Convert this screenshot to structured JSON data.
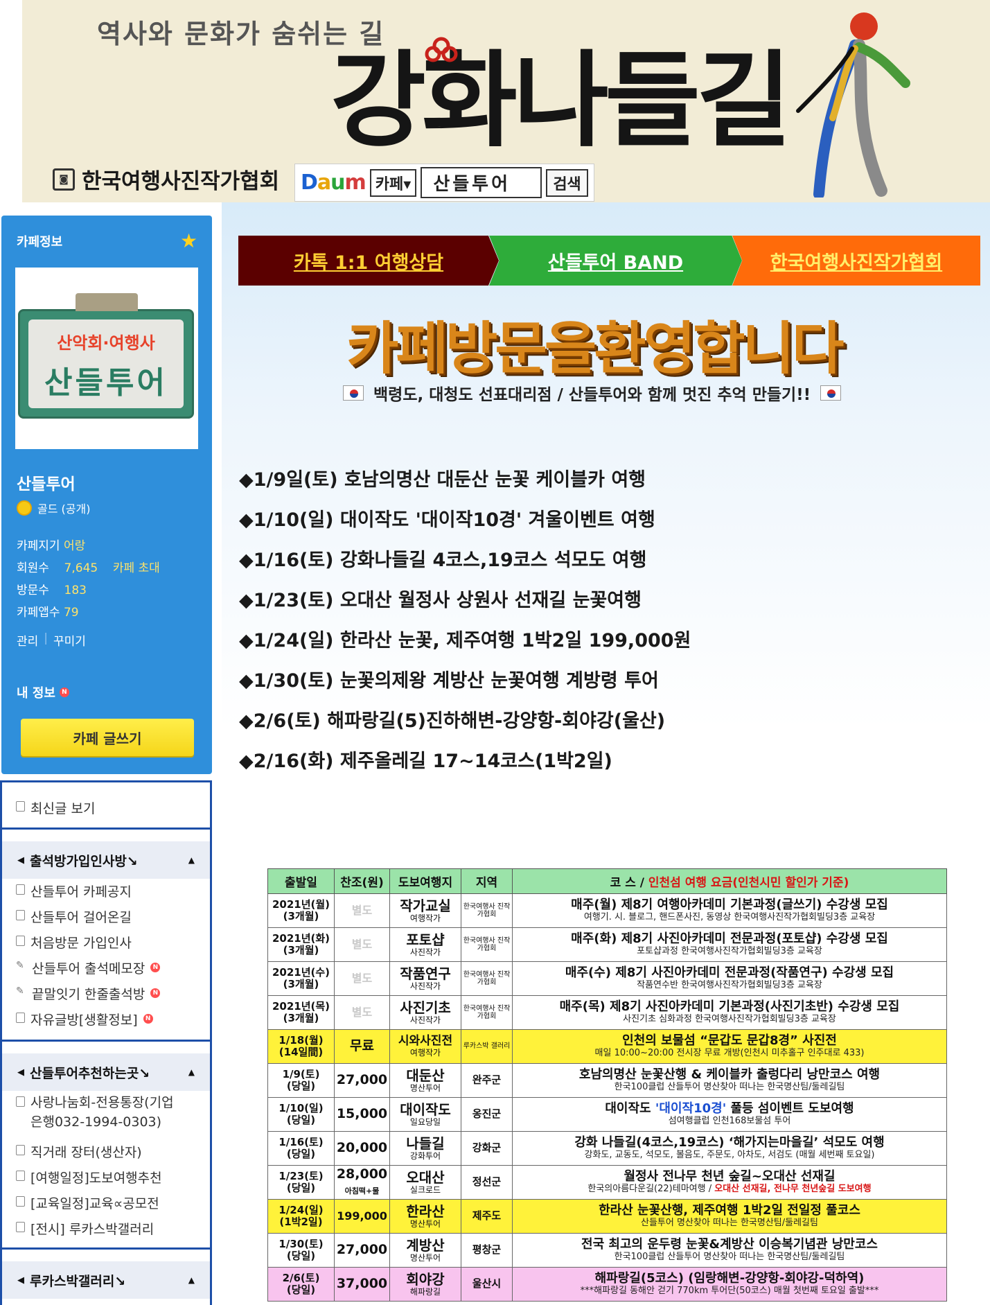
{
  "banner": {
    "subtitle": "역사와 문화가 숨쉬는 길",
    "title": "강화나들길",
    "association": "한국여행사진작가협회",
    "daum": {
      "logo": [
        "D",
        "a",
        "u",
        "m"
      ],
      "select": "카페▾",
      "query": "산들투어",
      "search": "검색"
    }
  },
  "sidebar": {
    "header": "카페정보",
    "thumb_top": "산악회·여행사",
    "thumb_main": "산들투어",
    "cafe_name": "산들투어",
    "grade": "골드 (공개)",
    "cafe_age_label": "카페지기",
    "cafe_age_value": "어랑",
    "members_label": "회원수",
    "members_value": "7,645",
    "invite_label": "카페 초대",
    "visits_label": "방문수",
    "visits_value": "183",
    "apps_label": "카페앱수",
    "apps_value": "79",
    "manage": "관리",
    "decorate": "꾸미기",
    "myinfo": "내 정보",
    "new_badge": "N",
    "write_button": "카페 글쓰기",
    "recent": "최신글 보기",
    "groups": [
      {
        "title": "출석방가입인사방↘",
        "items": [
          {
            "label": "산들투어 카페공지",
            "icon": "doc"
          },
          {
            "label": "산들투어 걸어온길",
            "icon": "doc"
          },
          {
            "label": "처음방문 가입인사",
            "icon": "doc"
          },
          {
            "label": "산들투어 출석메모장",
            "icon": "pen",
            "badge": "N"
          },
          {
            "label": "끝말잇기 한줄출석방",
            "icon": "pen",
            "badge": "N"
          },
          {
            "label": "자유글방[생활정보]",
            "icon": "doc",
            "badge": "N"
          }
        ]
      },
      {
        "title": "산들투어추천하는곳↘",
        "items": [
          {
            "label": "사랑나눔회-전용통장(기업은행032-1994-0303)",
            "label_line1": "사랑나눔회-전용통장(기업",
            "label_line2": "은행032-1994-0303)",
            "icon": "doc"
          },
          {
            "label": "직거래 장터(생산자)",
            "icon": "doc"
          },
          {
            "label": "[여행일정]도보여행추천",
            "icon": "doc"
          },
          {
            "label": "[교육일정]교육∝공모전",
            "icon": "doc"
          },
          {
            "label": "[전시] 루카스박갤러리",
            "icon": "doc"
          }
        ]
      },
      {
        "title": "루카스박갤러리↘",
        "items": []
      }
    ]
  },
  "tabs": [
    "카톡 1:1 여행상담",
    "산들투어 BAND",
    "한국여행사진작가협회"
  ],
  "welcome": "카페방문을환영합니다",
  "slogan": "백령도, 대청도 선표대리점 / 산들투어와 함께 멋진 추억 만들기!!",
  "schedule": [
    "◆1/9일(토) 호남의명산 대둔산 눈꽃 케이블카 여행",
    "◆1/10(일) 대이작도 '대이작10경' 겨울이벤트 여행",
    "◆1/16(토) 강화나들길 4코스,19코스 석모도 여행",
    "◆1/23(토) 오대산 월정사 상원사 선재길 눈꽃여행",
    "◆1/24(일) 한라산 눈꽃, 제주여행 1박2일 199,000원",
    "◆1/30(토) 눈꽃의제왕 계방산 눈꽃여행 계방령 투어",
    "◆2/6(토) 해파랑길(5)진하해변-강양항-회야강(울산)",
    "◆2/16(화) 제주올레길 17~14코스(1박2일)"
  ],
  "table": {
    "headers": [
      "출발일",
      "찬조(원)",
      "도보여행지",
      "지역"
    ],
    "course_header": "코 스 / ",
    "course_header_red": "인천섬 여행 요금(인천시민 할인가 기준)",
    "rows": [
      {
        "date1": "2021년(월)",
        "date2": "(3개월)",
        "price": "별도",
        "place": "작가교실",
        "place_sub": "여행작가",
        "region": "한국여행사 진작가협회",
        "course": "매주(월) 제8기 여행아카데미 기본과정(글쓰기) 수강생 모집",
        "desc": "여행기. 시. 블로그, 핸드폰사진, 동영상 한국여행사진작가협회빌딩3층 교육장",
        "style": ""
      },
      {
        "date1": "2021년(화)",
        "date2": "(3개월)",
        "price": "별도",
        "place": "포토샵",
        "place_sub": "사진작가",
        "region": "한국여행사 진작가협회",
        "course": "매주(화) 제8기 사진아카데미 전문과정(포토샵) 수강생 모집",
        "desc": "포토샵과정 한국여행사진작가협회빌딩3층 교육장",
        "style": ""
      },
      {
        "date1": "2021년(수)",
        "date2": "(3개월)",
        "price": "별도",
        "place": "작품연구",
        "place_sub": "사진작가",
        "region": "한국여행사 진작가협회",
        "course": "매주(수) 제8기 사진아카데미 전문과정(작품연구) 수강생 모집",
        "desc": "작품연수반 한국여행사진작가협회빌딩3층 교육장",
        "style": ""
      },
      {
        "date1": "2021년(목)",
        "date2": "(3개월)",
        "price": "별도",
        "place": "사진기초",
        "place_sub": "사진작가",
        "region": "한국여행사 진작가협회",
        "course": "매주(목) 제8기 사진아카데미 기본과정(사진기초반) 수강생 모집",
        "desc": "사진기초 심화과정 한국여행사진작가협회빌딩3층 교육장",
        "style": ""
      },
      {
        "date1": "1/18(월)",
        "date2": "(14일間)",
        "price": "무료",
        "place": "시와사진전",
        "place_sub": "여행작가",
        "region": "루카스박 갤러리",
        "course": "인천의 보물섬 “문갑도 문갑8경” 사진전",
        "desc": "매일 10:00~20:00 전시장 무료 개방(인천시 미추홀구 인주대로 433)",
        "style": "yellow"
      },
      {
        "date1": "1/9(토)",
        "date2": "(당일)",
        "price": "27,000",
        "place": "대둔산",
        "place_sub": "명산투어",
        "region": "완주군",
        "course": "호남의명산 눈꽃산행 & 케이블카 출렁다리 낭만코스 여행",
        "desc": "한국100클럽 산들투어 명산찾아 떠나는 한국명산팀/둘레길팀",
        "style": ""
      },
      {
        "date1": "1/10(일)",
        "date2": "(당일)",
        "price": "15,000",
        "place": "대이작도",
        "place_sub": "일요당일",
        "region": "옹진군",
        "course_a": "대이작도 ",
        "course_hl": "'대이작10경'",
        "course_b": " 풀등 섬이벤트 도보여행",
        "desc": "섬여행클럽 인천168보물섬 투어",
        "style": ""
      },
      {
        "date1": "1/16(토)",
        "date2": "(당일)",
        "price": "20,000",
        "place": "나들길",
        "place_sub": "강화투어",
        "region": "강화군",
        "course": "강화 나들길(4코스,19코스) ‘해가지는마을길’ 석모도 여행",
        "desc": "강화도, 교동도, 석모도, 볼음도, 주문도, 아차도, 서검도 (매월 세번째 토요일)",
        "style": ""
      },
      {
        "date1": "1/23(토)",
        "date2": "(당일)",
        "price": "28,000",
        "price_sub": "아침떡+물",
        "place": "오대산",
        "place_sub": "실크로드",
        "region": "정선군",
        "course": "월정사 전나무 천년 숲길~오대산 선재길",
        "desc_a": "한국의아름다운길(22)테마여행 / ",
        "desc_r": "오대산 선재길, 전나무 천년숲길 도보여행",
        "style": ""
      },
      {
        "date1": "1/24(일)",
        "date2": "(1박2일)",
        "price": "199,000",
        "place": "한라산",
        "place_sub": "명산투어",
        "region": "제주도",
        "course": "한라산 눈꽃산행, 제주여행 1박2일 전일정 풀코스",
        "desc": "산들투어 명산찾아 떠나는 한국명산팀/둘레길팀",
        "style": "yellow"
      },
      {
        "date1": "1/30(토)",
        "date2": "(당일)",
        "price": "27,000",
        "place": "계방산",
        "place_sub": "명산투어",
        "region": "평창군",
        "course": "전국 최고의 운두령 눈꽃&계방산 이승복기념관 낭만코스",
        "desc": "한국100클럽 산들투어 명산찾아 떠나는 한국명산팀/둘레길팀",
        "style": ""
      },
      {
        "date1": "2/6(토)",
        "date2": "(당일)",
        "price": "37,000",
        "place": "회야강",
        "place_sub": "해파랑길",
        "region": "울산시",
        "course": "해파랑길(5코스) (임랑해변-강양항-회야강-덕하역)",
        "desc": "***해파랑길 동해안 걷기 770km 투어단(50코스) 매월 첫번째 토요일 출발***",
        "style": "pink"
      }
    ]
  }
}
